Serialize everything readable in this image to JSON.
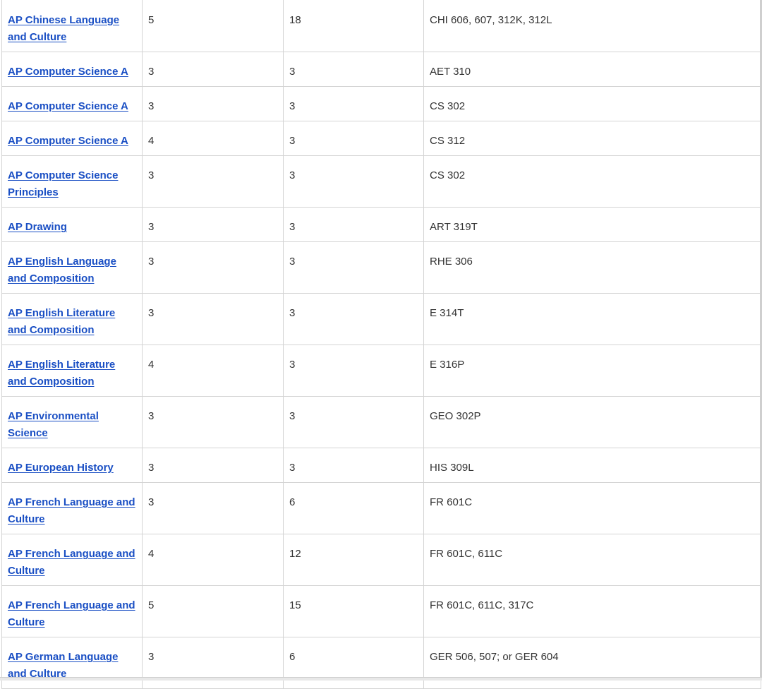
{
  "rows": [
    {
      "course": "AP Chinese Language and Culture",
      "score": "5",
      "hours": "18",
      "equivalent": "CHI 606, 607, 312K, 312L"
    },
    {
      "course": "AP Computer Science A",
      "score": "3",
      "hours": "3",
      "equivalent": "AET 310"
    },
    {
      "course": "AP Computer Science A",
      "score": "3",
      "hours": "3",
      "equivalent": "CS 302"
    },
    {
      "course": "AP Computer Science A",
      "score": "4",
      "hours": "3",
      "equivalent": "CS 312"
    },
    {
      "course": "AP Computer Science Principles",
      "score": "3",
      "hours": "3",
      "equivalent": "CS 302"
    },
    {
      "course": "AP Drawing",
      "score": "3",
      "hours": "3",
      "equivalent": "ART 319T"
    },
    {
      "course": "AP English Language and Composition",
      "score": "3",
      "hours": "3",
      "equivalent": "RHE 306"
    },
    {
      "course": "AP English Literature and Composition",
      "score": "3",
      "hours": "3",
      "equivalent": "E 314T"
    },
    {
      "course": "AP English Literature and Composition",
      "score": "4",
      "hours": "3",
      "equivalent": "E 316P"
    },
    {
      "course": "AP Environmental Science",
      "score": "3",
      "hours": "3",
      "equivalent": "GEO 302P"
    },
    {
      "course": "AP European History",
      "score": "3",
      "hours": "3",
      "equivalent": "HIS 309L"
    },
    {
      "course": "AP French Language and Culture",
      "score": "3",
      "hours": "6",
      "equivalent": "FR 601C"
    },
    {
      "course": "AP French Language and Culture",
      "score": "4",
      "hours": "12",
      "equivalent": "FR 601C, 611C"
    },
    {
      "course": "AP French Language and Culture",
      "score": "5",
      "hours": "15",
      "equivalent": "FR 601C, 611C, 317C"
    },
    {
      "course": "AP German Language and Culture",
      "score": "3",
      "hours": "6",
      "equivalent": "GER 506, 507; or GER 604"
    }
  ],
  "colors": {
    "link": "#1a4fc4",
    "text": "#333333",
    "border": "#d4d4d4"
  }
}
